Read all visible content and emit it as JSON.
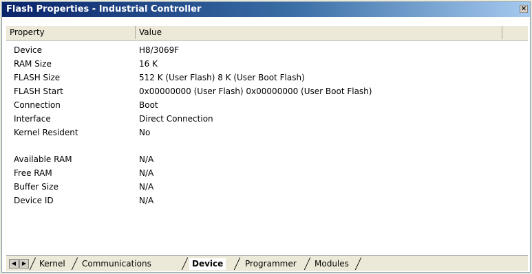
{
  "window": {
    "title": "Flash Properties - Industrial Controller",
    "close_glyph": "×"
  },
  "table": {
    "columns": [
      "Property",
      "Value"
    ],
    "rows": [
      {
        "key": "Device",
        "value": "H8/3069F"
      },
      {
        "key": "RAM Size",
        "value": "16 K"
      },
      {
        "key": "FLASH Size",
        "value": "512 K (User Flash)   8 K (User Boot Flash)"
      },
      {
        "key": "FLASH Start",
        "value": "0x00000000 (User Flash)   0x00000000 (User Boot Flash)"
      },
      {
        "key": "Connection",
        "value": "Boot"
      },
      {
        "key": "Interface",
        "value": "Direct Connection"
      },
      {
        "key": "Kernel Resident",
        "value": "No"
      },
      {
        "key": "Available RAM",
        "value": "N/A"
      },
      {
        "key": "Free RAM",
        "value": "N/A"
      },
      {
        "key": "Buffer Size",
        "value": "N/A"
      },
      {
        "key": "Device ID",
        "value": "N/A"
      }
    ]
  },
  "tabs": {
    "prev_glyph": "◀",
    "next_glyph": "▶",
    "items": [
      "Kernel",
      "Communications",
      "Device",
      "Programmer",
      "Modules"
    ],
    "active": "Device"
  }
}
